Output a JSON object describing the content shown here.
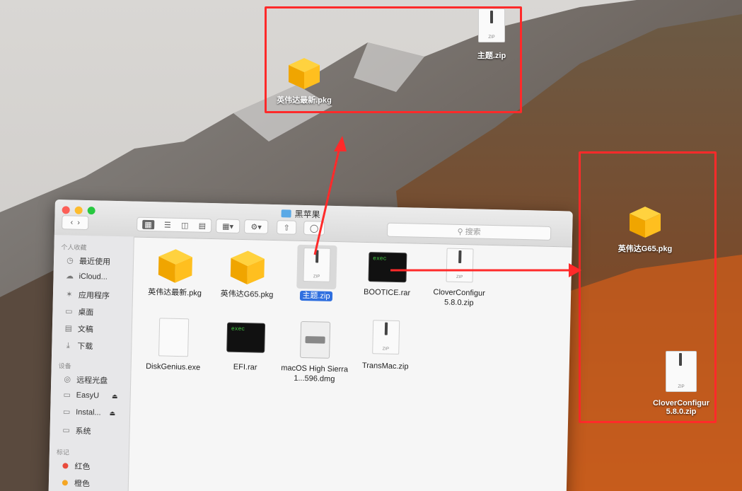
{
  "desktop": {
    "icons": [
      {
        "label": "英伟达最新.pkg",
        "icon": "package-icon"
      },
      {
        "label": "主题.zip",
        "icon": "zip-icon"
      },
      {
        "label": "英伟达G65.pkg",
        "icon": "package-icon"
      },
      {
        "label": "CloverConfigur 5.8.0.zip",
        "icon": "zip-icon"
      }
    ]
  },
  "finder": {
    "title": "黑苹果",
    "search_placeholder": "搜索",
    "sidebar": {
      "favorites_header": "个人收藏",
      "favorites": [
        {
          "label": "最近使用",
          "icon": "clock-icon"
        },
        {
          "label": "iCloud...",
          "icon": "cloud-icon"
        },
        {
          "label": "应用程序",
          "icon": "apps-icon"
        },
        {
          "label": "桌面",
          "icon": "desktop-icon"
        },
        {
          "label": "文稿",
          "icon": "document-icon"
        },
        {
          "label": "下载",
          "icon": "download-icon"
        }
      ],
      "devices_header": "设备",
      "devices": [
        {
          "label": "远程光盘",
          "icon": "disc-icon"
        },
        {
          "label": "EasyU",
          "icon": "drive-icon"
        },
        {
          "label": "Instal...",
          "icon": "drive-icon"
        },
        {
          "label": "系统",
          "icon": "drive-icon"
        }
      ],
      "tags_header": "标记",
      "tags": [
        {
          "label": "红色",
          "color": "#e94b3c"
        },
        {
          "label": "橙色",
          "color": "#f5a623"
        }
      ]
    },
    "files": [
      {
        "name": "英伟达最新.pkg",
        "icon": "package-icon"
      },
      {
        "name": "英伟达G65.pkg",
        "icon": "package-icon"
      },
      {
        "name": "主题.zip",
        "icon": "zip-icon",
        "selected": true
      },
      {
        "name": "BOOTICE.rar",
        "icon": "exec-icon"
      },
      {
        "name": "CloverConfigur 5.8.0.zip",
        "icon": "zip-icon"
      },
      {
        "name": "DiskGenius.exe",
        "icon": "blank-document-icon"
      },
      {
        "name": "EFI.rar",
        "icon": "exec-icon"
      },
      {
        "name": "macOS High Sierra 1...596.dmg",
        "icon": "disk-image-icon"
      },
      {
        "name": "TransMac.zip",
        "icon": "zip-icon"
      }
    ]
  },
  "annotation_colors": {
    "box": "#ff2a2a",
    "arrow": "#ff2a2a"
  }
}
